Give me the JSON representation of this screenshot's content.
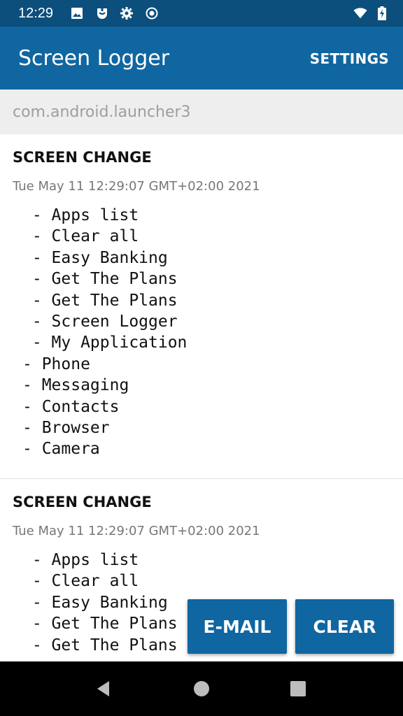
{
  "status_bar": {
    "time": "12:29",
    "left_icons": [
      "image-icon",
      "app-notification-icon",
      "settings-gear-icon",
      "record-icon"
    ],
    "right_icons": [
      "wifi-icon",
      "battery-charging-icon"
    ]
  },
  "app_bar": {
    "title": "Screen Logger",
    "settings_label": "SETTINGS"
  },
  "package_bar": {
    "package_name": "com.android.launcher3"
  },
  "log_entries": [
    {
      "title": "SCREEN CHANGE",
      "date": "Tue May 11 12:29:07 GMT+02:00 2021",
      "items": [
        " - Apps list",
        " - Clear all",
        " - Easy Banking",
        " - Get The Plans",
        " - Get The Plans",
        " - Screen Logger",
        " - My Application",
        "- Phone",
        "- Messaging",
        "- Contacts",
        "- Browser",
        "- Camera"
      ]
    },
    {
      "title": "SCREEN CHANGE",
      "date": "Tue May 11 12:29:07 GMT+02:00 2021",
      "items": [
        " - Apps list",
        " - Clear all",
        " - Easy Banking",
        " - Get The Plans",
        " - Get The Plans"
      ]
    }
  ],
  "buttons": {
    "email_label": "E-MAIL",
    "clear_label": "CLEAR"
  },
  "nav_bar": {
    "icons": [
      "back-icon",
      "home-icon",
      "recents-icon"
    ]
  },
  "colors": {
    "status_bar": "#0c4f7c",
    "app_bar": "#1066a0",
    "button": "#0f66a1",
    "package_bar": "#eeeeee"
  }
}
